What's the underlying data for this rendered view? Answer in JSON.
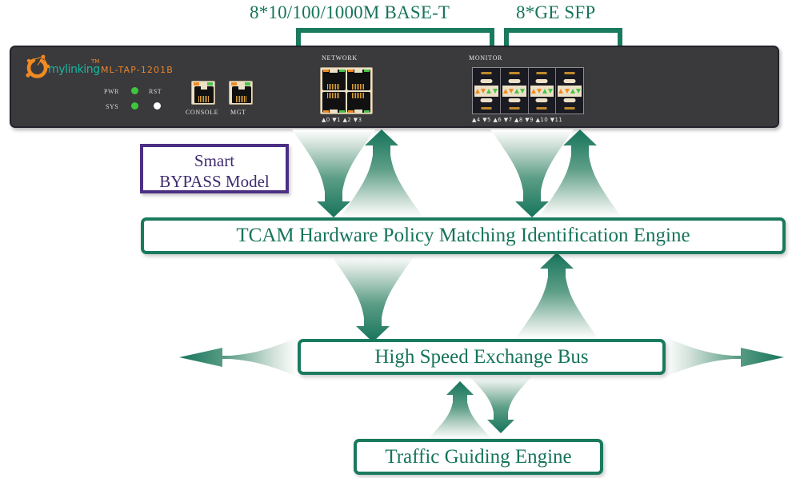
{
  "diagram": {
    "title": "ML-TAP-1201B network TAP architecture diagram",
    "accent_green": "#16745b",
    "accent_purple": "#4c2f83",
    "chassis_color": "#3a3a3c",
    "led_green": "#3ec73e",
    "led_orange": "#f08a22"
  },
  "top_labels": {
    "base_t": "8*10/100/1000M BASE-T",
    "sfp": "8*GE SFP"
  },
  "device": {
    "brand": "mylinking",
    "trademark": "TM",
    "model": "ML-TAP-1201B",
    "indicators": [
      {
        "label": "PWR",
        "state": "green"
      },
      {
        "label": "SYS",
        "state": "green"
      },
      {
        "label": "RST",
        "state": "white"
      }
    ],
    "led_labels": {
      "pwr": "PWR",
      "sys": "SYS",
      "rst": "RST"
    },
    "mgmt_ports": [
      {
        "caption": "CONSOLE"
      },
      {
        "caption": "MGT"
      }
    ],
    "groups": [
      {
        "caption": "NETWORK",
        "port_numbers": "▲0 ▼1   ▲2 ▼3"
      },
      {
        "caption": "MONITOR",
        "port_numbers": "▲4 ▼5   ▲6 ▼7   ▲8 ▼9  ▲10 ▼11"
      }
    ],
    "network_caption": "NETWORK",
    "monitor_caption": "MONITOR",
    "network_port_numbers": "▲0 ▼1   ▲2 ▼3",
    "monitor_port_numbers": "▲4 ▼5   ▲6 ▼7   ▲8 ▼9  ▲10 ▼11"
  },
  "callouts": {
    "bypass_line1": "Smart",
    "bypass_line2": "BYPASS Model"
  },
  "blocks": {
    "tcam": "TCAM Hardware Policy Matching Identification Engine",
    "bus": "High Speed Exchange Bus",
    "traffic": "Traffic Guiding Engine"
  },
  "flows": [
    {
      "name": "network-down-to-tcam",
      "direction": "down"
    },
    {
      "name": "tcam-up-to-network",
      "direction": "up"
    },
    {
      "name": "monitor-down-to-tcam",
      "direction": "down"
    },
    {
      "name": "tcam-up-to-monitor",
      "direction": "up"
    },
    {
      "name": "tcam-down-to-bus",
      "direction": "down"
    },
    {
      "name": "bus-up-to-tcam",
      "direction": "up"
    },
    {
      "name": "bus-out-left",
      "direction": "left"
    },
    {
      "name": "bus-out-right",
      "direction": "right"
    },
    {
      "name": "traffic-up-to-bus",
      "direction": "up"
    },
    {
      "name": "bus-down-to-traffic",
      "direction": "down"
    }
  ]
}
